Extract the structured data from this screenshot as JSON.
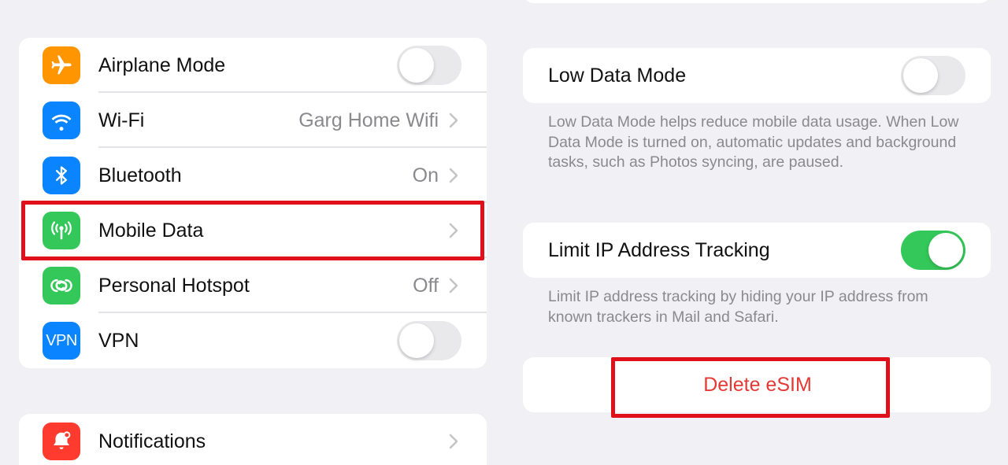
{
  "settings_list": {
    "items": [
      {
        "label": "Airplane Mode",
        "value": "",
        "icon": "airplane-icon",
        "color": "#ff9500",
        "control": "toggle",
        "toggle_on": false
      },
      {
        "label": "Wi-Fi",
        "value": "Garg Home Wifi",
        "icon": "wifi-icon",
        "color": "#0a84ff",
        "control": "chevron"
      },
      {
        "label": "Bluetooth",
        "value": "On",
        "icon": "bluetooth-icon",
        "color": "#0a84ff",
        "control": "chevron"
      },
      {
        "label": "Mobile Data",
        "value": "",
        "icon": "antenna-icon",
        "color": "#34c759",
        "control": "chevron",
        "highlighted": true
      },
      {
        "label": "Personal Hotspot",
        "value": "Off",
        "icon": "hotspot-icon",
        "color": "#34c759",
        "control": "chevron"
      },
      {
        "label": "VPN",
        "value": "",
        "icon": "vpn-icon",
        "icon_text": "VPN",
        "color": "#0a84ff",
        "control": "toggle",
        "toggle_on": false
      }
    ]
  },
  "notifications_row": {
    "label": "Notifications",
    "icon": "bell-icon",
    "color": "#ff3b30"
  },
  "low_data": {
    "label": "Low Data Mode",
    "toggle_on": false,
    "footnote": "Low Data Mode helps reduce mobile data usage. When Low Data Mode is turned on, automatic updates and background tasks, such as Photos syncing, are paused."
  },
  "limit_ip": {
    "label": "Limit IP Address Tracking",
    "toggle_on": true,
    "footnote": "Limit IP address tracking by hiding your IP address from known trackers in Mail and Safari."
  },
  "delete_esim": {
    "label": "Delete eSIM",
    "highlighted": true
  },
  "colors": {
    "highlight": "#e0101a",
    "destructive": "#e53935",
    "toggle_on": "#34c759"
  }
}
